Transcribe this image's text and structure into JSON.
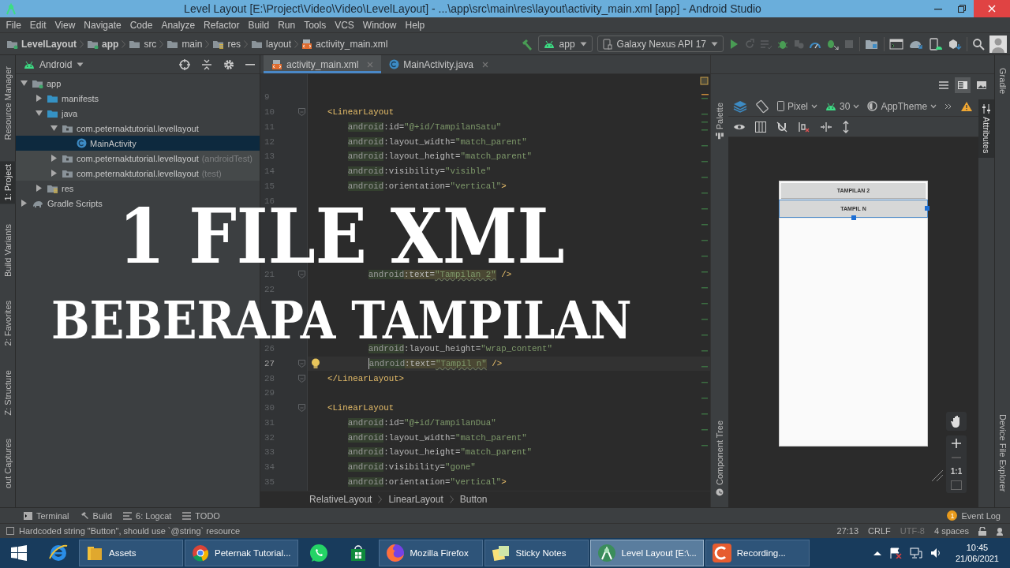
{
  "window": {
    "title": "Level Layout [E:\\Project\\Video\\Video\\LevelLayout] - ...\\app\\src\\main\\res\\layout\\activity_main.xml [app] - Android Studio"
  },
  "menu": [
    "File",
    "Edit",
    "View",
    "Navigate",
    "Code",
    "Analyze",
    "Refactor",
    "Build",
    "Run",
    "Tools",
    "VCS",
    "Window",
    "Help"
  ],
  "breadcrumbs": [
    {
      "label": "LevelLayout",
      "kind": "module"
    },
    {
      "label": "app",
      "kind": "module"
    },
    {
      "label": "src",
      "kind": "folder"
    },
    {
      "label": "main",
      "kind": "folder"
    },
    {
      "label": "res",
      "kind": "res"
    },
    {
      "label": "layout",
      "kind": "folder"
    },
    {
      "label": "activity_main.xml",
      "kind": "xml"
    }
  ],
  "run_config": {
    "module": "app",
    "device": "Galaxy Nexus API 17"
  },
  "left_tabs": [
    {
      "label": "Resource Manager",
      "selected": false
    },
    {
      "label": "1: Project",
      "selected": true
    },
    {
      "label": "Build Variants",
      "selected": false
    },
    {
      "label": "2: Favorites",
      "selected": false
    },
    {
      "label": "Z: Structure",
      "selected": false
    },
    {
      "label": "out Captures",
      "selected": false
    }
  ],
  "right_tabs": [
    "Gradle",
    "Device File Explorer"
  ],
  "project": {
    "view": "Android",
    "tree": [
      {
        "label": "app",
        "kind": "module",
        "expanded": true,
        "selected": false,
        "children": [
          {
            "label": "manifests",
            "kind": "folder",
            "expanded": false,
            "selected": false
          },
          {
            "label": "java",
            "kind": "folder",
            "expanded": true,
            "selected": false,
            "children": [
              {
                "label": "com.peternaktutorial.levellayout",
                "kind": "package",
                "expanded": true,
                "selected": false,
                "children": [
                  {
                    "label": "MainActivity",
                    "kind": "class",
                    "selected": true
                  }
                ]
              },
              {
                "label": "com.peternaktutorial.levellayout",
                "hint": "(androidTest)",
                "kind": "test-package",
                "expanded": false,
                "selected": false
              },
              {
                "label": "com.peternaktutorial.levellayout",
                "hint": "(test)",
                "kind": "test-package",
                "expanded": false,
                "selected": false
              }
            ]
          },
          {
            "label": "res",
            "kind": "res",
            "expanded": false,
            "selected": false
          }
        ]
      },
      {
        "label": "Gradle Scripts",
        "kind": "gradle",
        "expanded": false,
        "selected": false
      }
    ]
  },
  "editor": {
    "tabs": [
      {
        "label": "activity_main.xml",
        "kind": "xml",
        "selected": true
      },
      {
        "label": "MainActivity.java",
        "kind": "class",
        "selected": false
      }
    ],
    "lines": [
      {
        "num": "9",
        "current": false,
        "fold": false
      },
      {
        "kind": "element",
        "num": "10",
        "current": false,
        "fold": true,
        "tokens": [
          {
            "kind": "tag",
            "text": "<LinearLayout"
          }
        ]
      },
      {
        "kind": "attribute",
        "num": "11",
        "current": false,
        "fold": false,
        "tokens": [
          {
            "kind": "ns",
            "text": "android"
          },
          {
            "kind": "attr",
            "text": ":id="
          },
          {
            "kind": "value",
            "text": "\"@+id/TampilanSatu\""
          }
        ]
      },
      {
        "kind": "attribute",
        "num": "12",
        "current": false,
        "fold": false,
        "tokens": [
          {
            "kind": "ns",
            "text": "android"
          },
          {
            "kind": "attr",
            "text": ":layout_width="
          },
          {
            "kind": "value",
            "text": "\"match_parent\""
          }
        ]
      },
      {
        "kind": "attribute",
        "num": "13",
        "current": false,
        "fold": false,
        "tokens": [
          {
            "kind": "ns",
            "text": "android"
          },
          {
            "kind": "attr",
            "text": ":layout_height="
          },
          {
            "kind": "value",
            "text": "\"match_parent\""
          }
        ]
      },
      {
        "kind": "attribute",
        "num": "14",
        "current": false,
        "fold": false,
        "tokens": [
          {
            "kind": "ns",
            "text": "android"
          },
          {
            "kind": "attr",
            "text": ":visibility="
          },
          {
            "kind": "value",
            "text": "\"visible\""
          }
        ]
      },
      {
        "kind": "attribute",
        "num": "15",
        "current": false,
        "fold": false,
        "tokens": [
          {
            "kind": "ns",
            "text": "android"
          },
          {
            "kind": "attr",
            "text": ":orientation="
          },
          {
            "kind": "value",
            "text": "\"vertical\""
          },
          {
            "kind": "tag",
            "text": ">"
          }
        ]
      },
      {
        "num": "16",
        "current": false,
        "fold": false
      },
      {
        "kind": "covered"
      },
      {
        "kind": "covered"
      },
      {
        "kind": "covered"
      },
      {
        "kind": "covered"
      },
      {
        "kind": "nested-attribute",
        "num": "21",
        "current": false,
        "fold": true,
        "tokens": [
          {
            "kind": "ns",
            "text": "android"
          },
          {
            "kind": "warn-attr",
            "text": ":text="
          },
          {
            "kind": "warn-value",
            "text": "\"Tampilan 2\""
          },
          {
            "kind": "tag",
            "text": " />"
          }
        ]
      },
      {
        "num": "22",
        "current": false,
        "fold": false
      },
      {
        "kind": "covered"
      },
      {
        "kind": "covered"
      },
      {
        "kind": "covered"
      },
      {
        "kind": "nested-attribute",
        "num": "26",
        "current": false,
        "fold": false,
        "tokens": [
          {
            "kind": "ns",
            "text": "android"
          },
          {
            "kind": "attr",
            "text": ":layout_height="
          },
          {
            "kind": "value",
            "text": "\"wrap_content\""
          }
        ]
      },
      {
        "kind": "nested-attribute",
        "num": "27",
        "current": true,
        "fold": true,
        "tokens": [
          {
            "kind": "ns",
            "text": "android"
          },
          {
            "kind": "warn-attr",
            "text": ":text="
          },
          {
            "kind": "warn-value",
            "text": "\"Tampil n\""
          },
          {
            "kind": "tag",
            "text": " />"
          }
        ]
      },
      {
        "kind": "element",
        "num": "28",
        "current": false,
        "fold": true,
        "tokens": [
          {
            "kind": "tag",
            "text": "</LinearLayout>"
          }
        ]
      },
      {
        "num": "29",
        "current": false,
        "fold": false
      },
      {
        "kind": "element",
        "num": "30",
        "current": false,
        "fold": true,
        "tokens": [
          {
            "kind": "tag",
            "text": "<LinearLayout"
          }
        ]
      },
      {
        "kind": "attribute",
        "num": "31",
        "current": false,
        "fold": false,
        "tokens": [
          {
            "kind": "ns",
            "text": "android"
          },
          {
            "kind": "attr",
            "text": ":id="
          },
          {
            "kind": "value",
            "text": "\"@+id/TampilanDua\""
          }
        ]
      },
      {
        "kind": "attribute",
        "num": "32",
        "current": false,
        "fold": false,
        "tokens": [
          {
            "kind": "ns",
            "text": "android"
          },
          {
            "kind": "attr",
            "text": ":layout_width="
          },
          {
            "kind": "value",
            "text": "\"match_parent\""
          }
        ]
      },
      {
        "kind": "attribute",
        "num": "33",
        "current": false,
        "fold": false,
        "tokens": [
          {
            "kind": "ns",
            "text": "android"
          },
          {
            "kind": "attr",
            "text": ":layout_height="
          },
          {
            "kind": "value",
            "text": "\"match_parent\""
          }
        ]
      },
      {
        "kind": "attribute",
        "num": "34",
        "current": false,
        "fold": false,
        "tokens": [
          {
            "kind": "ns",
            "text": "android"
          },
          {
            "kind": "attr",
            "text": ":visibility="
          },
          {
            "kind": "value",
            "text": "\"gone\""
          }
        ]
      },
      {
        "kind": "attribute",
        "num": "35",
        "current": false,
        "fold": false,
        "tokens": [
          {
            "kind": "ns",
            "text": "android"
          },
          {
            "kind": "attr",
            "text": ":orientation="
          },
          {
            "kind": "value",
            "text": "\"vertical\""
          },
          {
            "kind": "tag",
            "text": ">"
          }
        ]
      }
    ],
    "breadcrumb": [
      "RelativeLayout",
      "LinearLayout",
      "Button"
    ]
  },
  "designer": {
    "left_tabs": [
      "Palette",
      "Component Tree"
    ],
    "right_tabs": [
      "Attributes"
    ],
    "device": "Pixel",
    "api": "30",
    "theme": "AppTheme",
    "zoom_label": "1:1",
    "preview_buttons": [
      {
        "label": "TAMPILAN 2",
        "selected": false
      },
      {
        "label": "TAMPIL N",
        "selected": true
      }
    ]
  },
  "tool_windows": [
    "Terminal",
    "Build",
    "6: Logcat",
    "TODO"
  ],
  "event_log": {
    "label": "Event Log",
    "count": "1"
  },
  "status": {
    "message": "Hardcoded string \"Button\", should use `@string` resource",
    "position": "27:13",
    "line_separator": "CRLF",
    "encoding": "UTF-8",
    "indent": "4 spaces"
  },
  "taskbar": {
    "apps": [
      {
        "kind": "browser-e",
        "selected": false
      },
      {
        "kind": "folder",
        "label": "Assets",
        "selected": false
      },
      {
        "kind": "chrome",
        "label": "Peternak Tutorial...",
        "selected": false
      },
      {
        "kind": "chat",
        "selected": false
      },
      {
        "kind": "store",
        "selected": false
      },
      {
        "kind": "firefox",
        "label": "Mozilla Firefox",
        "selected": false
      },
      {
        "kind": "notes",
        "label": "Sticky Notes",
        "selected": false
      },
      {
        "kind": "studio",
        "label": "Level Layout [E:\\...",
        "selected": true
      },
      {
        "kind": "recorder",
        "label": "Recording...",
        "selected": false
      }
    ],
    "time": "10:45",
    "date": "21/06/2021"
  },
  "overlay": {
    "lines": [
      "1 FILE XML",
      "BEBERAPA TAMPILAN"
    ]
  }
}
